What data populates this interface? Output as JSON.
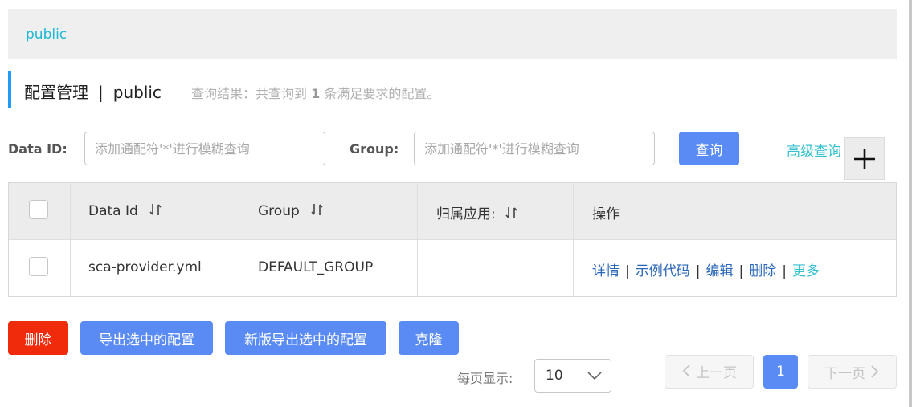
{
  "namespace_bar": {
    "link": "public"
  },
  "header": {
    "title": "配置管理",
    "separator": "|",
    "namespace": "public",
    "result_prefix": "查询结果：共查询到",
    "result_count": "1",
    "result_suffix": "条满足要求的配置。"
  },
  "search": {
    "data_id_label": "Data ID:",
    "data_id_placeholder": "添加通配符'*'进行模糊查询",
    "group_label": "Group:",
    "group_placeholder": "添加通配符'*'进行模糊查询",
    "query_label": "查询",
    "advanced_label": "高级查询"
  },
  "table": {
    "headers": {
      "data_id": "Data Id",
      "group": "Group",
      "app": "归属应用:",
      "actions": "操作"
    },
    "rows": [
      {
        "data_id": "sca-provider.yml",
        "group": "DEFAULT_GROUP",
        "app": ""
      }
    ],
    "actions": {
      "detail": "详情",
      "sample": "示例代码",
      "edit": "编辑",
      "delete": "删除",
      "more": "更多",
      "sep": "|"
    }
  },
  "buttons": {
    "delete": "删除",
    "export_selected": "导出选中的配置",
    "new_export_selected": "新版导出选中的配置",
    "clone": "克隆"
  },
  "pagination": {
    "page_size_label": "每页显示:",
    "page_size": "10",
    "prev": "上一页",
    "current_page": "1",
    "next": "下一页"
  },
  "colors": {
    "primary": "#5a8bf5",
    "danger": "#f02b0b",
    "link": "#1fb8d6",
    "accent": "#209bfa"
  },
  "icons": [
    "sort-icon",
    "plus-icon",
    "chevron-down-icon",
    "chevron-left-icon",
    "chevron-right-icon"
  ]
}
